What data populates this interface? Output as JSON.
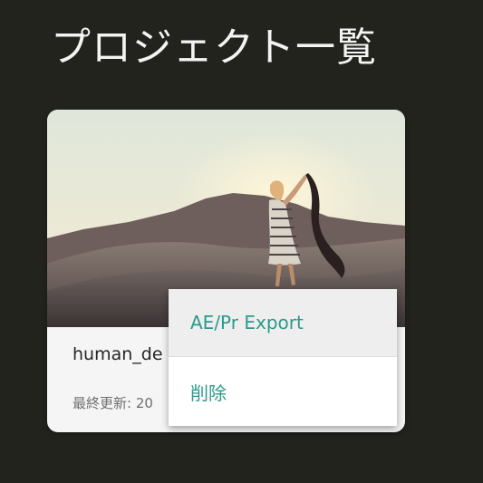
{
  "page": {
    "title": "プロジェクト一覧"
  },
  "projects": [
    {
      "name": "human_de",
      "last_updated_label": "最終更新: 20",
      "thumbnail": "desert-woman-scarf-photo"
    }
  ],
  "context_menu": {
    "items": [
      {
        "label": "AE/Pr Export",
        "state": "hovered"
      },
      {
        "label": "削除",
        "state": "normal"
      }
    ]
  },
  "colors": {
    "background": "#23231e",
    "title_text": "#f4f4f4",
    "card_background": "#f5f5f5",
    "menu_accent": "#2b9a8c",
    "menu_hover": "#eeeeee"
  }
}
